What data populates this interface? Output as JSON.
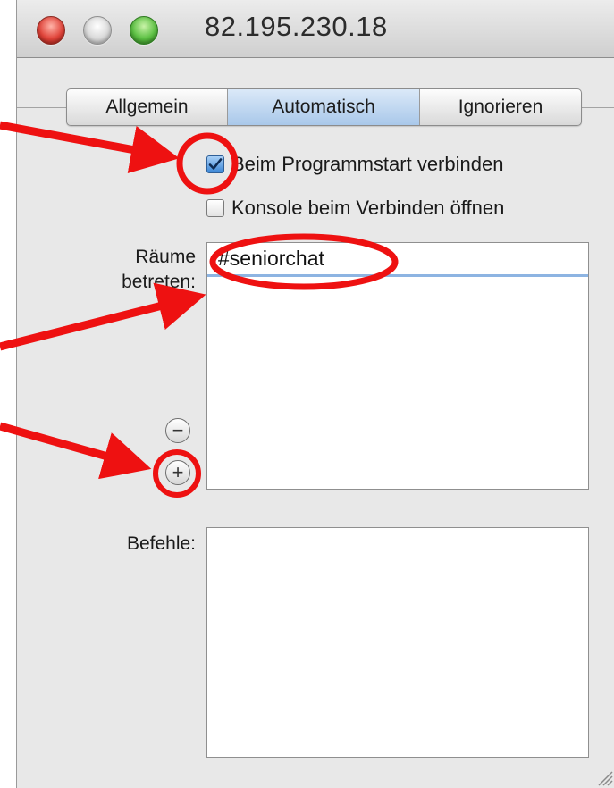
{
  "window": {
    "title": "82.195.230.18"
  },
  "tabs": [
    {
      "label": "Allgemein",
      "selected": false
    },
    {
      "label": "Automatisch",
      "selected": true
    },
    {
      "label": "Ignorieren",
      "selected": false
    }
  ],
  "options": {
    "connect_on_start": {
      "label": "Beim Programmstart verbinden",
      "checked": true
    },
    "open_console": {
      "label": "Konsole beim Verbinden öffnen",
      "checked": false
    }
  },
  "rooms": {
    "label_line1": "Räume",
    "label_line2": "betreten:",
    "items": [
      "#seniorchat"
    ],
    "remove_symbol": "−",
    "add_symbol": "+"
  },
  "commands": {
    "label": "Befehle:"
  },
  "annotation_color": "#ee1111"
}
